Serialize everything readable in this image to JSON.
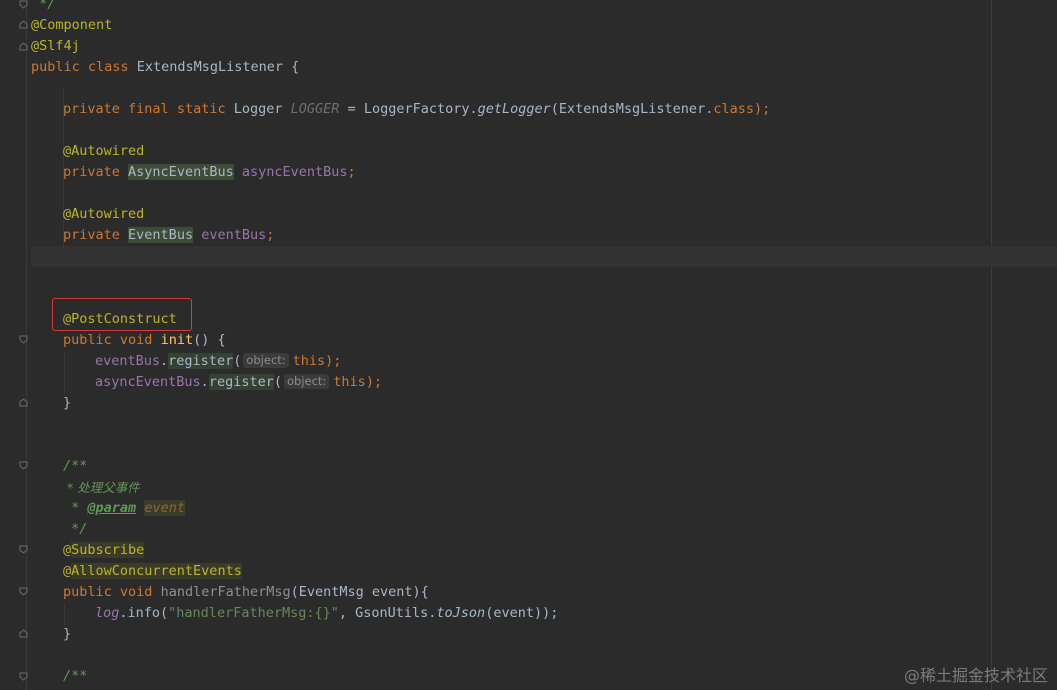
{
  "editor": {
    "lines": {
      "comment_end": " */",
      "ann_component": "@Component",
      "ann_slf4j": "@Slf4j",
      "class_kw1": "public",
      "class_kw2": "class",
      "class_name": "ExtendsMsgListener {",
      "logger_private": "private",
      "logger_final": "final",
      "logger_static": "static",
      "logger_type": "Logger ",
      "logger_name": "LOGGER",
      "logger_assign": " = LoggerFactory.",
      "logger_call": "getLogger",
      "logger_args": "(ExtendsMsgListener.",
      "logger_class": "class",
      "logger_end": ");",
      "autowired1": "@Autowired",
      "async_private": "private",
      "async_type": "AsyncEventBus",
      "async_field": "asyncEventBus",
      "async_end": ";",
      "autowired2": "@Autowired",
      "bus_private": "private",
      "bus_type": "EventBus",
      "bus_field": "eventBus",
      "bus_end": ";",
      "postconstruct": "@PostConstruct",
      "init_public": "public",
      "init_void": "void",
      "init_name": "init",
      "init_rest": "() {",
      "reg1_field": "eventBus",
      "reg1_dot": ".",
      "reg1_call": "register",
      "reg1_open": "(",
      "reg1_hint": "object:",
      "reg1_this": "this",
      "reg1_end": ");",
      "reg2_field": "asyncEventBus",
      "reg2_dot": ".",
      "reg2_call": "register",
      "reg2_open": "(",
      "reg2_hint": "object:",
      "reg2_this": "this",
      "reg2_end": ");",
      "close_brace1": "}",
      "doc_open": "/**",
      "doc_desc": " * 处理父事件",
      "doc_star": " * ",
      "doc_tag": "@param",
      "doc_param": "event",
      "doc_close": " */",
      "subscribe_at": "@",
      "subscribe_name": "Subscribe",
      "allow_at": "@",
      "allow_name": "AllowConcurrentEvents",
      "handler_public": "public",
      "handler_void": "void",
      "handler_name": "handlerFatherMsg",
      "handler_args": "(EventMsg event){",
      "log_field": "log",
      "log_info": ".info(",
      "log_str": "\"handlerFatherMsg:{}\"",
      "log_mid": ", GsonUtils.",
      "log_call": "toJson",
      "log_end": "(event));",
      "close_brace2": "}",
      "doc_open2": "/**"
    }
  },
  "watermark": "@稀土掘金技术社区",
  "colors": {
    "background": "#2b2b2b",
    "keyword": "#cc7832",
    "annotation": "#bbb529",
    "string": "#6a8759",
    "field": "#9876aa",
    "method": "#ffc66d",
    "highlight_box": "#d43a3a"
  }
}
